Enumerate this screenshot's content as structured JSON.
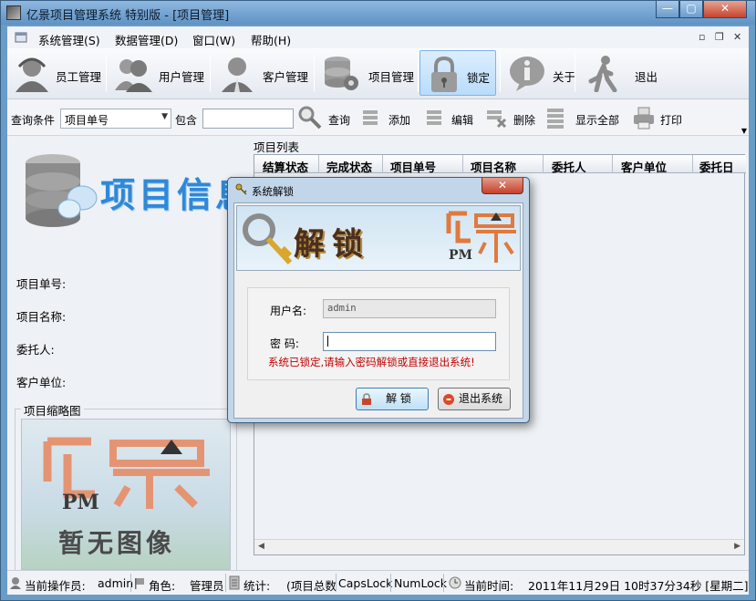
{
  "window": {
    "title": "亿景项目管理系统 特别版 - [项目管理]",
    "min": "—",
    "max": "▢",
    "close": "✕"
  },
  "menu": [
    "系统管理(S)",
    "数据管理(D)",
    "窗口(W)",
    "帮助(H)"
  ],
  "mdi_controls": [
    "▫",
    "❐",
    "✕"
  ],
  "toolbar": [
    {
      "label": "员工管理",
      "icon": "employee-icon"
    },
    {
      "label": "用户管理",
      "icon": "users-icon"
    },
    {
      "label": "客户管理",
      "icon": "customer-icon"
    },
    {
      "label": "项目管理",
      "icon": "database-gear-icon"
    },
    {
      "label": "锁定",
      "icon": "lock-icon"
    },
    {
      "label": "关于",
      "icon": "info-icon"
    },
    {
      "label": "退出",
      "icon": "exit-icon"
    }
  ],
  "search": {
    "condition_label": "查询条件",
    "condition_value": "项目单号",
    "contains_label": "包含",
    "actions": [
      "查询",
      "添加",
      "编辑",
      "删除",
      "显示全部",
      "打印"
    ]
  },
  "left": {
    "banner": "项目信息",
    "fields": [
      "项目单号:",
      "项目名称:",
      "委托人:",
      "客户单位:"
    ],
    "thumbnail_group": "项目缩略图",
    "thumb_logo": "PM",
    "thumb_text": "暂无图像"
  },
  "right": {
    "title": "项目列表",
    "columns": [
      "结算状态",
      "完成状态",
      "项目单号",
      "项目名称",
      "委托人",
      "客户单位",
      "委托日"
    ]
  },
  "status": {
    "operator_label": "当前操作员:",
    "operator": "admin",
    "role_label": "角色:",
    "role": "管理员",
    "stats_label": "统计:",
    "stats": "(项目总数",
    "caps": "CapsLock",
    "num": "NumLock",
    "time_label": "当前时间:",
    "time": "2011年11月29日 10时37分34秒 [星期二]"
  },
  "dialog": {
    "title": "系统解锁",
    "banner_text": "解锁",
    "banner_logo": "PM",
    "username_label": "用户名:",
    "username_value": "admin",
    "password_label": "密  码:",
    "password_value": "",
    "message": "系统已锁定,请输入密码解锁或直接退出系统!",
    "unlock_button": "解  锁",
    "exit_button": "退出系统",
    "close": "✕"
  }
}
